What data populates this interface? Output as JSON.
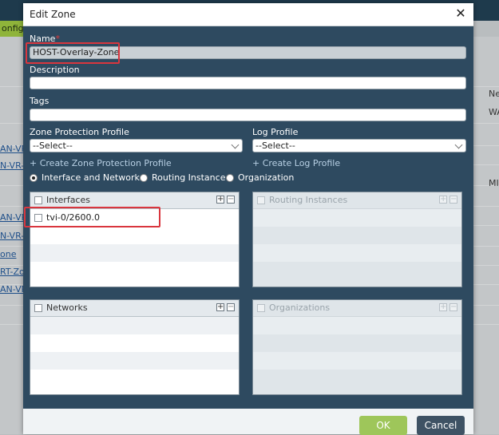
{
  "background": {
    "tab_fragment": "onfig",
    "left_links": [
      "AN-VR",
      "N-VR-",
      "AN-VR",
      "N-VR-",
      "one",
      "RT-Zo",
      "AN-VR-"
    ],
    "right_fragments": [
      "Ne",
      "WA",
      "MI"
    ]
  },
  "dialog": {
    "title": "Edit Zone",
    "close_icon": "close-icon",
    "name_label": "Name",
    "name_required": "*",
    "name_value": "HOST-Overlay-Zone",
    "description_label": "Description",
    "description_value": "",
    "tags_label": "Tags",
    "tags_value": "",
    "zone_protection_label": "Zone Protection Profile",
    "zone_protection_value": "--Select--",
    "log_profile_label": "Log Profile",
    "log_profile_value": "--Select--",
    "create_zone_protection_link": "+ Create Zone Protection Profile",
    "create_log_profile_link": "+ Create Log Profile",
    "radios": [
      {
        "label": "Interface and Networks",
        "selected": true
      },
      {
        "label": "Routing Instance",
        "selected": false
      },
      {
        "label": "Organization",
        "selected": false
      }
    ],
    "panels": {
      "interfaces": {
        "title": "Interfaces",
        "rows": [
          "tvi-0/2600.0"
        ]
      },
      "routing_instances": {
        "title": "Routing Instances",
        "rows": []
      },
      "networks": {
        "title": "Networks",
        "rows": []
      },
      "organizations": {
        "title": "Organizations",
        "rows": []
      }
    },
    "ok_label": "OK",
    "cancel_label": "Cancel"
  },
  "colors": {
    "dialog_body": "#2e4a60",
    "ok_button": "#9ec65a",
    "cancel_button": "#3e5264",
    "highlight": "#d9363e"
  }
}
